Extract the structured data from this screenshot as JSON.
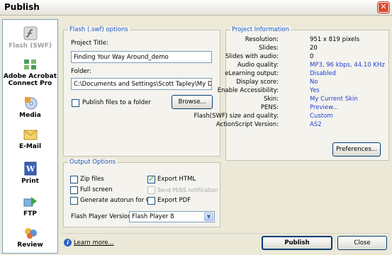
{
  "window": {
    "title": "Publish",
    "close_glyph": "✕"
  },
  "sidebar": {
    "items": [
      {
        "label": "Flash (SWF)",
        "icon": "flash-icon",
        "selected": true
      },
      {
        "label": "Adobe Acrobat Connect Pro",
        "label_line1": "Adobe Acrobat",
        "label_line2": "Connect Pro",
        "icon": "connect-icon"
      },
      {
        "label": "Media",
        "icon": "media-icon"
      },
      {
        "label": "E-Mail",
        "icon": "email-icon"
      },
      {
        "label": "Print",
        "icon": "print-icon"
      },
      {
        "label": "FTP",
        "icon": "ftp-icon"
      },
      {
        "label": "Review",
        "icon": "review-icon"
      }
    ]
  },
  "flash_options": {
    "title": "Flash (.swf) options",
    "project_title_label": "Project Title:",
    "project_title_value": "Finding Your Way Around_demo",
    "folder_label": "Folder:",
    "folder_value": "C:\\Documents and Settings\\Scott Tapley\\My Docume",
    "publish_to_folder_label": "Publish files to a folder",
    "browse_label": "Browse..."
  },
  "output_options": {
    "title": "Output Options",
    "zip_files": "Zip files",
    "full_screen": "Full screen",
    "autorun": "Generate autorun for CD",
    "export_html": "Export HTML",
    "send_pens": "Send PENS notification",
    "export_pdf": "Export PDF",
    "player_version_label": "Flash Player Version:",
    "player_version_value": "Flash Player 8"
  },
  "project_info": {
    "title": "Project Information",
    "rows": [
      {
        "key": "Resolution:",
        "value": "951 x 819 pixels",
        "link": false
      },
      {
        "key": "Slides:",
        "value": "20",
        "link": false
      },
      {
        "key": "Slides with audio:",
        "value": "0",
        "link": false
      },
      {
        "key": "Audio quality:",
        "value": "MP3, 96 kbps, 44.10 KHz",
        "link": true
      },
      {
        "key": "eLearning output:",
        "value": "Disabled",
        "link": true
      },
      {
        "key": "Display score:",
        "value": "No",
        "link": true
      },
      {
        "key": "Enable Accessibility:",
        "value": "Yes",
        "link": true
      },
      {
        "key": "Skin:",
        "value": "My Current Skin",
        "link": true
      },
      {
        "key": "PENS:",
        "value": "Preview...",
        "link": true
      },
      {
        "key": "Flash(SWF) size and quality:",
        "value": "Custom",
        "link": true
      },
      {
        "key": "ActionScript Version:",
        "value": "AS2",
        "link": true
      }
    ],
    "preferences_label": "Preferences..."
  },
  "footer": {
    "learn_more": "Learn more...",
    "publish_label": "Publish",
    "close_label": "Close"
  }
}
